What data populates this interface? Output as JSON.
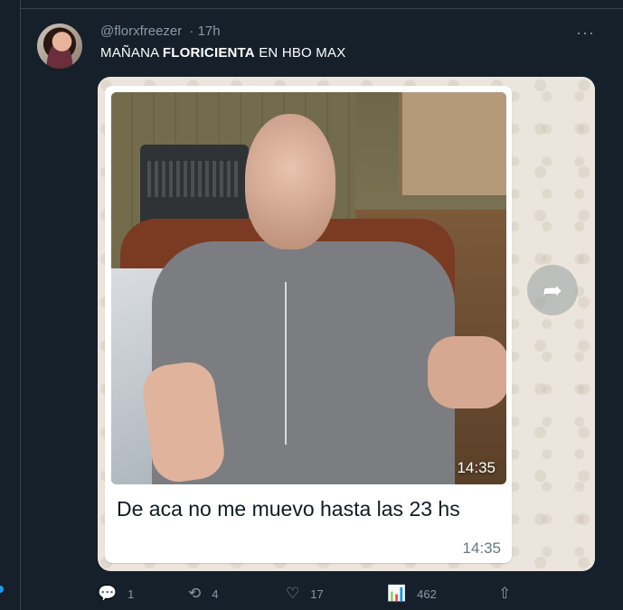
{
  "tweet": {
    "handle": "@florxfreezer",
    "dot": "·",
    "time": "17h",
    "text_part1": "MAÑANA ",
    "text_bold": "FLORICIENTA",
    "text_part2": " EN HBO MAX",
    "more_icon": "···"
  },
  "media": {
    "photo_time": "14:35",
    "message": "De aca no me muevo hasta las 23 hs",
    "message_time": "14:35",
    "forward_icon": "➦"
  },
  "actions": {
    "replies": {
      "icon": "💬",
      "count": "1"
    },
    "retweets": {
      "icon": "⟲",
      "count": "4"
    },
    "likes": {
      "icon": "♡",
      "count": "17"
    },
    "views": {
      "icon": "📊",
      "count": "462"
    },
    "share": {
      "icon": "⇧"
    }
  }
}
